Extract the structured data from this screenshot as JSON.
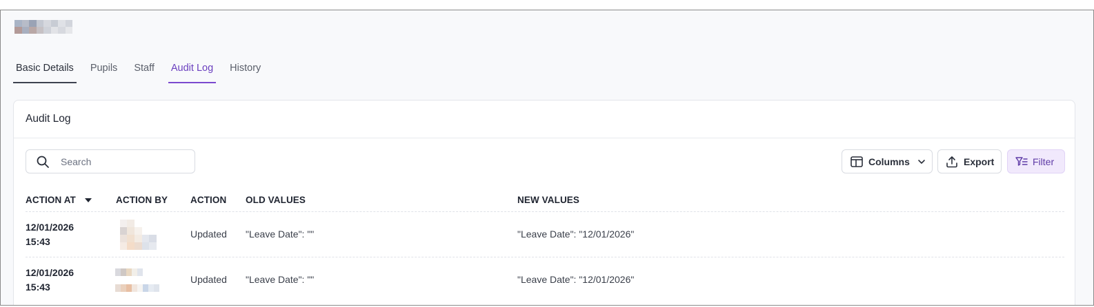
{
  "tabs": [
    "Basic Details",
    "Pupils",
    "Staff",
    "Audit Log",
    "History"
  ],
  "active_tab": "Audit Log",
  "card": {
    "title": "Audit Log"
  },
  "search": {
    "placeholder": "Search"
  },
  "toolbar": {
    "columns_label": "Columns",
    "export_label": "Export",
    "filter_label": "Filter"
  },
  "colors": {
    "accent": "#7b49cf",
    "filter_bg": "#f1e9fc"
  },
  "icons": {
    "search": "search-icon",
    "columns": "columns-icon",
    "chevron": "chevron-down-icon",
    "export": "upload-icon",
    "filter": "filter-icon",
    "sort": "sort-desc-icon"
  },
  "table": {
    "headers": [
      "ACTION AT",
      "ACTION BY",
      "ACTION",
      "OLD VALUES",
      "NEW VALUES"
    ],
    "sorted_column": "ACTION AT",
    "sort_direction": "descending",
    "rows": [
      {
        "date": "12/01/2026",
        "time": "15:43",
        "action": "Updated",
        "old_values": "\"Leave Date\": \"\"",
        "new_values": "\"Leave Date\": \"12/01/2026\""
      },
      {
        "date": "12/01/2026",
        "time": "15:43",
        "action": "Updated",
        "old_values": "\"Leave Date\": \"\"",
        "new_values": "\"Leave Date\": \"12/01/2026\""
      }
    ]
  }
}
